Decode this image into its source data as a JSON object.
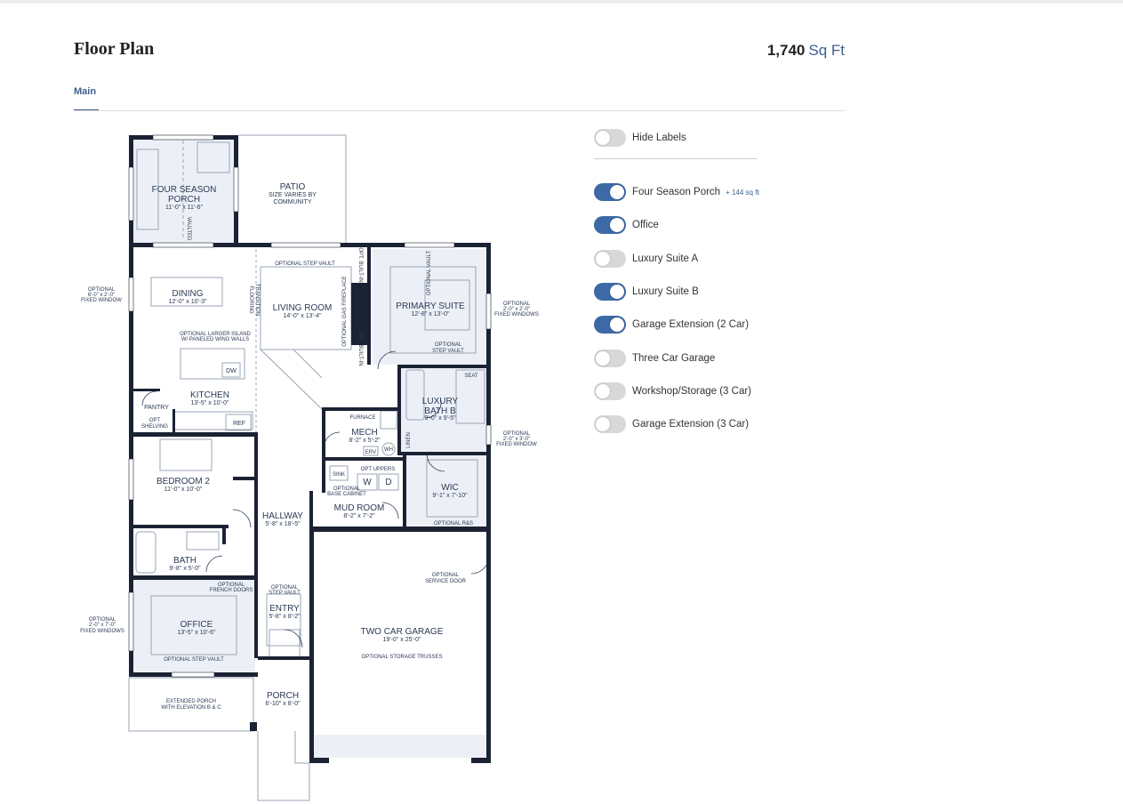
{
  "header": {
    "title": "Floor Plan",
    "sqft_value": "1,740",
    "sqft_unit": "Sq Ft"
  },
  "tabs": [
    {
      "label": "Main"
    }
  ],
  "rooms": {
    "four_season_porch": {
      "l1": "FOUR SEASON",
      "l2": "PORCH",
      "dim": "11'-0\" x 11'-6\""
    },
    "patio": {
      "name": "PATIO",
      "n1": "SIZE VARIES BY",
      "n2": "COMMUNITY"
    },
    "dining": {
      "name": "DINING",
      "dim": "12'-0\" x 10'-3\""
    },
    "living": {
      "name": "LIVING ROOM",
      "dim": "14'-0\" x 13'-4\""
    },
    "primary": {
      "name": "PRIMARY SUITE",
      "dim": "12'-8\" x 13'-0\""
    },
    "kitchen": {
      "name": "KITCHEN",
      "dim": "13'-5\" x 10'-0\""
    },
    "pantry": {
      "name": "PANTRY",
      "n1": "OPT",
      "n2": "SHELVING"
    },
    "luxury_bath": {
      "l1": "LUXURY",
      "l2": "BATH B",
      "dim": "9'-0\" x 9'-5\""
    },
    "mech": {
      "name": "MECH",
      "dim": "8'-2\" x 5'-2\""
    },
    "wic": {
      "name": "WIC",
      "dim": "9'-1\" x 7'-10\""
    },
    "bedroom2": {
      "name": "BEDROOM 2",
      "dim": "11'-0\" x 10'-0\""
    },
    "hallway": {
      "name": "HALLWAY",
      "dim": "5'-8\" x 18'-5\""
    },
    "mudroom": {
      "name": "MUD ROOM",
      "dim": "8'-2\" x 7'-2\""
    },
    "bath": {
      "name": "BATH",
      "dim": "9'-8\" x 5'-0\""
    },
    "office": {
      "name": "OFFICE",
      "dim": "13'-5\" x 10'-6\""
    },
    "entry": {
      "name": "ENTRY",
      "dim": "5'-8\" x 8'-2\""
    },
    "garage": {
      "name": "TWO CAR GARAGE",
      "dim": "19'-0\" x 25'-0\"",
      "note": "OPTIONAL STORAGE TRUSSES"
    },
    "porch": {
      "name": "PORCH",
      "dim": "6'-10\" x 8'-0\""
    }
  },
  "notes": {
    "vaulted": "VAULTED",
    "opt_step_vault": "OPTIONAL STEP VAULT",
    "opt_step_vault_b1": "OPTIONAL",
    "opt_step_vault_b2": "STEP VAULT",
    "flooring1": "FLOORING",
    "flooring2": "TRANSITION",
    "gas_fireplace": "OPTIONAL GAS FIREPLACE",
    "built_in1": "OPT. BUILT-IN",
    "built_in2": "OPT. BUILT-IN",
    "opt_vault": "OPTIONAL VAULT",
    "island1": "OPTIONAL LARGER ISLAND",
    "island2": "W/ PANELED WING WALLS",
    "dw": "DW",
    "ref": "REF",
    "seat": "SEAT",
    "furnace": "FURNACE",
    "erv": "ERV",
    "wh": "WH",
    "linen": "LINEN",
    "sink": "SINK",
    "w": "W",
    "d": "D",
    "opt_uppers": "OPT UPPERS",
    "base_cab1": "OPTIONAL",
    "base_cab2": "BASE CABINET",
    "optional_rs": "OPTIONAL R&S",
    "service_door1": "OPTIONAL",
    "service_door2": "SERVICE DOOR",
    "french_doors1": "OPTIONAL",
    "french_doors2": "FRENCH DOORS",
    "ext_porch1": "EXTENDED PORCH",
    "ext_porch2": "WITH ELEVATION B & C",
    "win_left1": {
      "a": "OPTIONAL",
      "b": "6'-0\" x 2'-0\"",
      "c": "FIXED WINDOW"
    },
    "win_right1": {
      "a": "OPTIONAL",
      "b": "2'-0\" x 2'-0\"",
      "c": "FIXED WINDOWS"
    },
    "win_right2": {
      "a": "OPTIONAL",
      "b": "2'-0\" x 3'-0\"",
      "c": "FIXED WINDOW"
    },
    "win_left2": {
      "a": "OPTIONAL",
      "b": "2'-0\" x 7'-0\"",
      "c": "FIXED WINDOWS"
    }
  },
  "options": {
    "hide_labels": {
      "label": "Hide Labels",
      "on": false
    },
    "items": [
      {
        "label": "Four Season Porch",
        "extra": "+ 144 sq ft",
        "on": true
      },
      {
        "label": "Office",
        "extra": "",
        "on": true
      },
      {
        "label": "Luxury Suite A",
        "extra": "",
        "on": false
      },
      {
        "label": "Luxury Suite B",
        "extra": "",
        "on": true
      },
      {
        "label": "Garage Extension (2 Car)",
        "extra": "",
        "on": true
      },
      {
        "label": "Three Car Garage",
        "extra": "",
        "on": false
      },
      {
        "label": "Workshop/Storage (3 Car)",
        "extra": "",
        "on": false
      },
      {
        "label": "Garage Extension (3 Car)",
        "extra": "",
        "on": false
      }
    ]
  },
  "colors": {
    "wall": "#1a2233",
    "accent": "#3d6aa6",
    "tint": "#ecf0f6",
    "label": "#2b3a55"
  }
}
